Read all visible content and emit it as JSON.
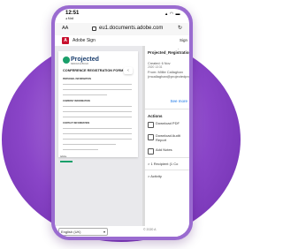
{
  "status": {
    "time": "12:51",
    "subtime": "◂ Mail",
    "icons": "▴ ◠ ▬"
  },
  "browser": {
    "aa": "AA",
    "url": "eu1.documents.adobe.com",
    "reload": "↻"
  },
  "app": {
    "logo": "A",
    "title": "Adobe Sign",
    "right_label": "Sign"
  },
  "document": {
    "brand": "Projected",
    "brand_sub": "DESIGN & BUILD",
    "title": "CONFERENCE REGISTRATION FORM",
    "sections": [
      "PERSONAL INFORMATION",
      "COMPANY INFORMATION",
      "CONTACT INFORMATION"
    ],
    "footer_tag": "Adobe"
  },
  "panel": {
    "title": "Projected_RegistrationForm",
    "created": "Created: 6 Nov",
    "date": "2020 13:31",
    "from": "From: Millie Callaghan (mcallaghan@projectedprogram.com)",
    "see_more": "See more",
    "actions_heading": "Actions",
    "actions": [
      {
        "icon": "pdf-icon",
        "label": "Download PDF"
      },
      {
        "icon": "audit-report-icon",
        "label": "Download Audit Report"
      },
      {
        "icon": "notes-icon",
        "label": "Add Notes"
      }
    ],
    "recipients": "> 1 Recipient (1 Co",
    "activity": "> Activity"
  },
  "footer": {
    "language": "English (UK)",
    "copyright": "© 2020 A"
  },
  "colors": {
    "accent": "#1473e6",
    "adobe_red": "#c8102e",
    "purple": "#8a45c8"
  }
}
